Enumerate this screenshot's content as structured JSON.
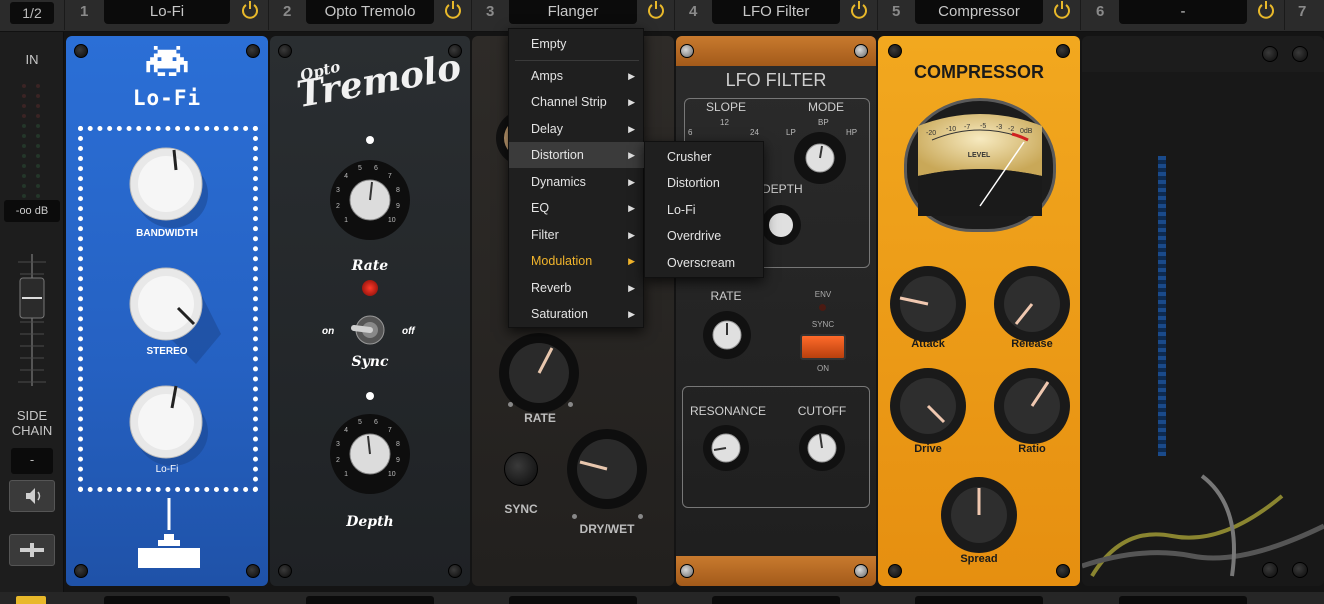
{
  "topbar": {
    "page_indicator": "1/2",
    "slots": [
      {
        "number": "1",
        "name": "Lo-Fi"
      },
      {
        "number": "2",
        "name": "Opto Tremolo"
      },
      {
        "number": "3",
        "name": "Flanger"
      },
      {
        "number": "4",
        "name": "LFO Filter"
      },
      {
        "number": "5",
        "name": "Compressor"
      },
      {
        "number": "6",
        "name": "-"
      },
      {
        "number": "7",
        "name": ""
      }
    ]
  },
  "input_strip": {
    "in_label": "IN",
    "level": "-oo dB",
    "side_label_1": "SIDE",
    "side_label_2": "CHAIN",
    "sidechain_value": "-"
  },
  "lofi": {
    "title": "Lo-Fi",
    "knob1": "BANDWIDTH",
    "knob2": "STEREO",
    "knob3": "Lo-Fi"
  },
  "tremolo": {
    "title_top": "Opto",
    "title_main": "Tremolo",
    "rate_label": "Rate",
    "on_label": "on",
    "off_label": "off",
    "sync_label": "Sync",
    "depth_label": "Depth",
    "rate_ticks": [
      "1",
      "2",
      "3",
      "4",
      "5",
      "6",
      "7",
      "8",
      "9",
      "10"
    ],
    "depth_ticks": [
      "1",
      "2",
      "3",
      "4",
      "5",
      "6",
      "7",
      "8",
      "9",
      "10"
    ]
  },
  "flanger": {
    "rate_label": "RATE",
    "sync_label": "SYNC",
    "drywet_label": "DRY/WET"
  },
  "lfo": {
    "title": "LFO FILTER",
    "slope_label": "SLOPE",
    "slope_6": "6",
    "slope_12": "12",
    "slope_24": "24",
    "mode_label": "MODE",
    "mode_lp": "LP",
    "mode_bp": "BP",
    "mode_hp": "HP",
    "depth_label": "DEPTH",
    "rate_label": "RATE",
    "env_label": "ENV",
    "sync_label": "SYNC",
    "on_label": "ON",
    "resonance_label": "RESONANCE",
    "cutoff_label": "CUTOFF"
  },
  "compressor": {
    "title": "COMPRESSOR",
    "vu_label": "LEVEL",
    "vu_scale": [
      "-20",
      "-10",
      "-7",
      "-5",
      "-3",
      "-2",
      "0dB"
    ],
    "attack": "Attack",
    "release": "Release",
    "drive": "Drive",
    "ratio": "Ratio",
    "spread": "Spread"
  },
  "menu": {
    "empty": "Empty",
    "items": [
      "Amps",
      "Channel Strip",
      "Delay",
      "Distortion",
      "Dynamics",
      "EQ",
      "Filter",
      "Modulation",
      "Reverb",
      "Saturation"
    ],
    "highlighted": "Distortion",
    "active": "Modulation",
    "submenu": [
      "Crusher",
      "Distortion",
      "Lo-Fi",
      "Overdrive",
      "Overscream"
    ]
  },
  "colors": {
    "accent": "#f2b52c",
    "lofi_blue": "#2b6fd6",
    "compressor_orange": "#f2a81f",
    "sync_led": "#ff2a1a"
  }
}
